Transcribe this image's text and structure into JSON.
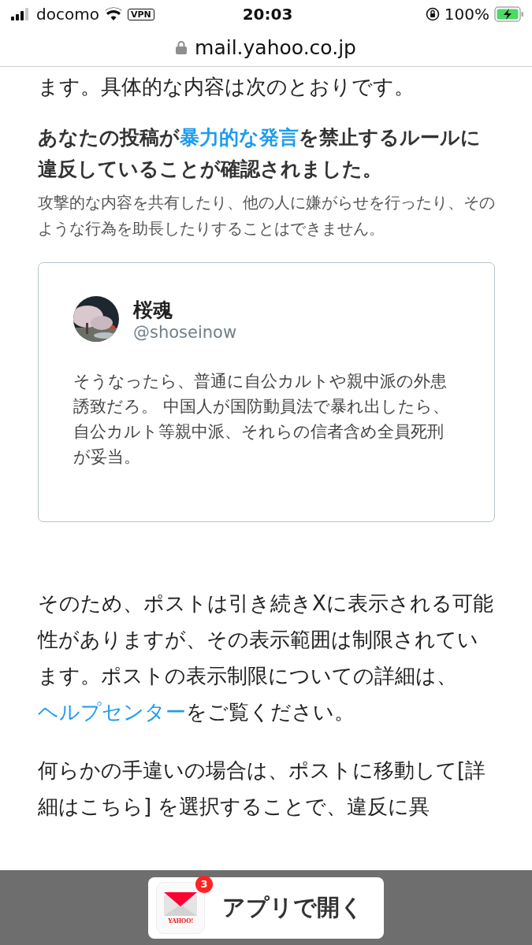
{
  "status_bar": {
    "carrier": "docomo",
    "vpn": "VPN",
    "time": "20:03",
    "battery": "100%"
  },
  "address_bar": {
    "url": "mail.yahoo.co.jp"
  },
  "intro": "ます。具体的な内容は次のとおりです。",
  "heading": [
    {
      "kind": "plain",
      "text": "あなたの投稿が"
    },
    {
      "kind": "link",
      "text": "暴力的な発言"
    },
    {
      "kind": "plain",
      "text": "を禁止するルールに違反していることが確認されました。"
    }
  ],
  "rule_description": "攻撃的な内容を共有したり、他の人に嫌がらせを行ったり、そのような行為を助長したりすることはできません。",
  "post": {
    "name": "桜魂",
    "handle": "@shoseinow",
    "text": "そうなったら、普通に自公カルトや親中派の外患誘致だろ。 中国人が国防動員法で暴れ出したら、自公カルト等親中派、それらの信者含め全員死刑が妥当。"
  },
  "paragraphs": [
    [
      {
        "kind": "plain",
        "text": "そのため、ポストは引き続きXに表示される可能性がありますが、その表示範囲は制限されています。ポストの表示制限についての詳細は、"
      },
      {
        "kind": "link",
        "text": "ヘルプセンター"
      },
      {
        "kind": "plain",
        "text": "をご覧ください。"
      }
    ],
    [
      {
        "kind": "plain",
        "text": "何らかの手違いの場合は、ポストに移動して[詳細はこちら] を選択することで、違反に異"
      }
    ]
  ],
  "open_in_app": {
    "label": "アプリで開く",
    "badge": "3",
    "logo_text": "YAHOO!"
  }
}
